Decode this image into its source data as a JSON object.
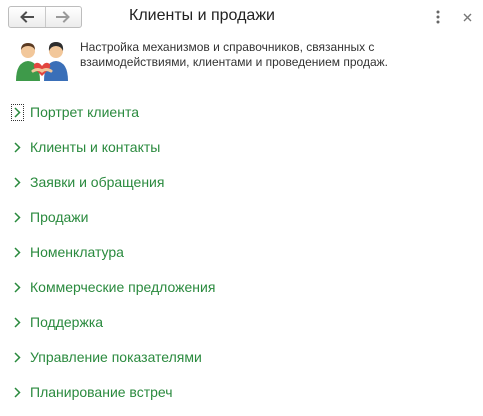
{
  "header": {
    "title": "Клиенты и продажи",
    "back_icon": "arrow-left-icon",
    "forward_icon": "arrow-right-icon",
    "more_icon": "more-vertical-icon",
    "close_icon": "close-icon"
  },
  "intro": {
    "icon": "people-handshake-icon",
    "description": "Настройка механизмов и справочников, связанных с взаимодействиями,  клиентами и проведением продаж."
  },
  "colors": {
    "link": "#2a8a3e",
    "text": "#333333",
    "icon_gray": "#4d4d4d"
  },
  "menu": {
    "items": [
      {
        "label": "Портрет клиента",
        "focused": true
      },
      {
        "label": "Клиенты и контакты"
      },
      {
        "label": "Заявки и обращения"
      },
      {
        "label": "Продажи"
      },
      {
        "label": "Номенклатура"
      },
      {
        "label": "Коммерческие предложения"
      },
      {
        "label": "Поддержка"
      },
      {
        "label": "Управление показателями"
      },
      {
        "label": "Планирование встреч"
      }
    ]
  }
}
